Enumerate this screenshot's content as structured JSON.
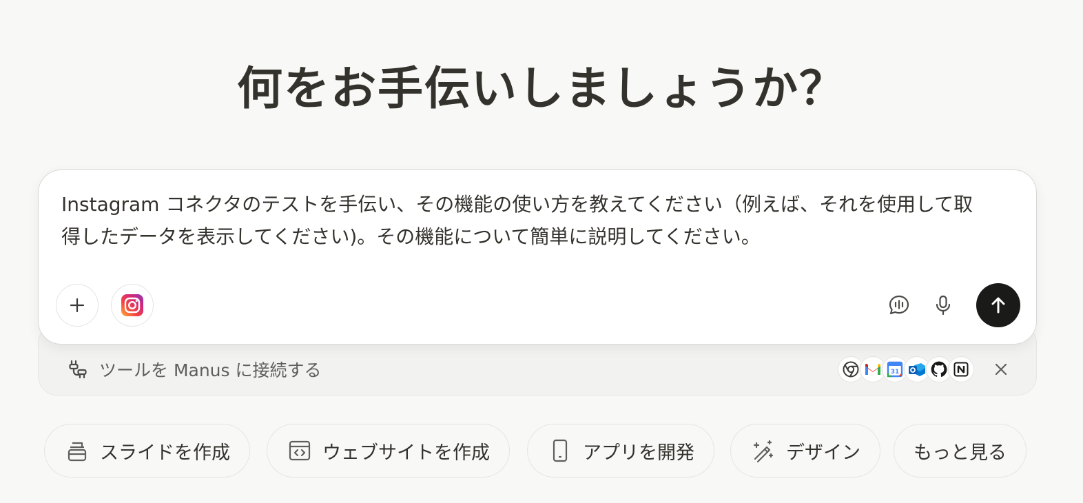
{
  "headline": "何をお手伝いしましょうか？",
  "composer": {
    "prompt": "Instagram コネクタのテストを手伝い、その機能の使い方を教えてください（例えば、それを使用して取\n得したデータを表示してください)。その機能について簡単に説明してください。",
    "attached_connector_icon": "instagram-icon",
    "accent": "#1a1a19"
  },
  "tools_bar": {
    "label": "ツールを Manus に接続する",
    "apps": [
      "chrome-icon",
      "gmail-icon",
      "google-calendar-icon",
      "outlook-icon",
      "github-icon",
      "notion-icon"
    ]
  },
  "quick_actions": [
    {
      "label": "スライドを作成",
      "icon": "slides-icon"
    },
    {
      "label": "ウェブサイトを作成",
      "icon": "website-code-icon"
    },
    {
      "label": "アプリを開発",
      "icon": "mobile-device-icon"
    },
    {
      "label": "デザイン",
      "icon": "magic-wand-icon"
    },
    {
      "label": "もっと見る",
      "icon": ""
    }
  ]
}
